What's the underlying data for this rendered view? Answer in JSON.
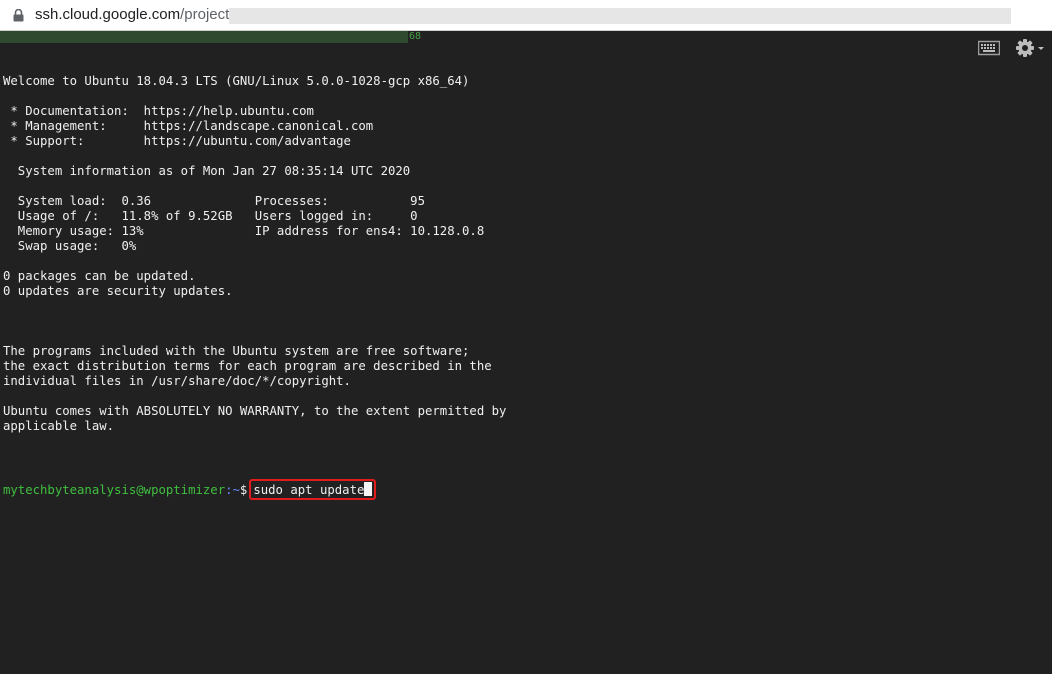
{
  "browser": {
    "url_host": "ssh.cloud.google.com",
    "url_path": "/projects/"
  },
  "progress": {
    "label": "68"
  },
  "terminal": {
    "lines": [
      "Welcome to Ubuntu 18.04.3 LTS (GNU/Linux 5.0.0-1028-gcp x86_64)",
      "",
      " * Documentation:  https://help.ubuntu.com",
      " * Management:     https://landscape.canonical.com",
      " * Support:        https://ubuntu.com/advantage",
      "",
      "  System information as of Mon Jan 27 08:35:14 UTC 2020",
      "",
      "  System load:  0.36              Processes:           95",
      "  Usage of /:   11.8% of 9.52GB   Users logged in:     0",
      "  Memory usage: 13%               IP address for ens4: 10.128.0.8",
      "  Swap usage:   0%",
      "",
      "0 packages can be updated.",
      "0 updates are security updates.",
      "",
      "",
      "",
      "The programs included with the Ubuntu system are free software;",
      "the exact distribution terms for each program are described in the",
      "individual files in /usr/share/doc/*/copyright.",
      "",
      "Ubuntu comes with ABSOLUTELY NO WARRANTY, to the extent permitted by",
      "applicable law.",
      ""
    ],
    "prompt": {
      "user_host": "mytechbyteanalysis@wpoptimizer",
      "path": ":~",
      "symbol": "$",
      "command": "sudo apt update"
    }
  },
  "colors": {
    "background": "#212121",
    "text": "#f0f0f0",
    "prompt_user": "#3fbf3f",
    "prompt_path": "#6b8cff",
    "highlight": "#e01b1b"
  },
  "icons": {
    "keyboard": "keyboard-icon",
    "settings": "gear-icon",
    "lock": "lock-icon"
  }
}
